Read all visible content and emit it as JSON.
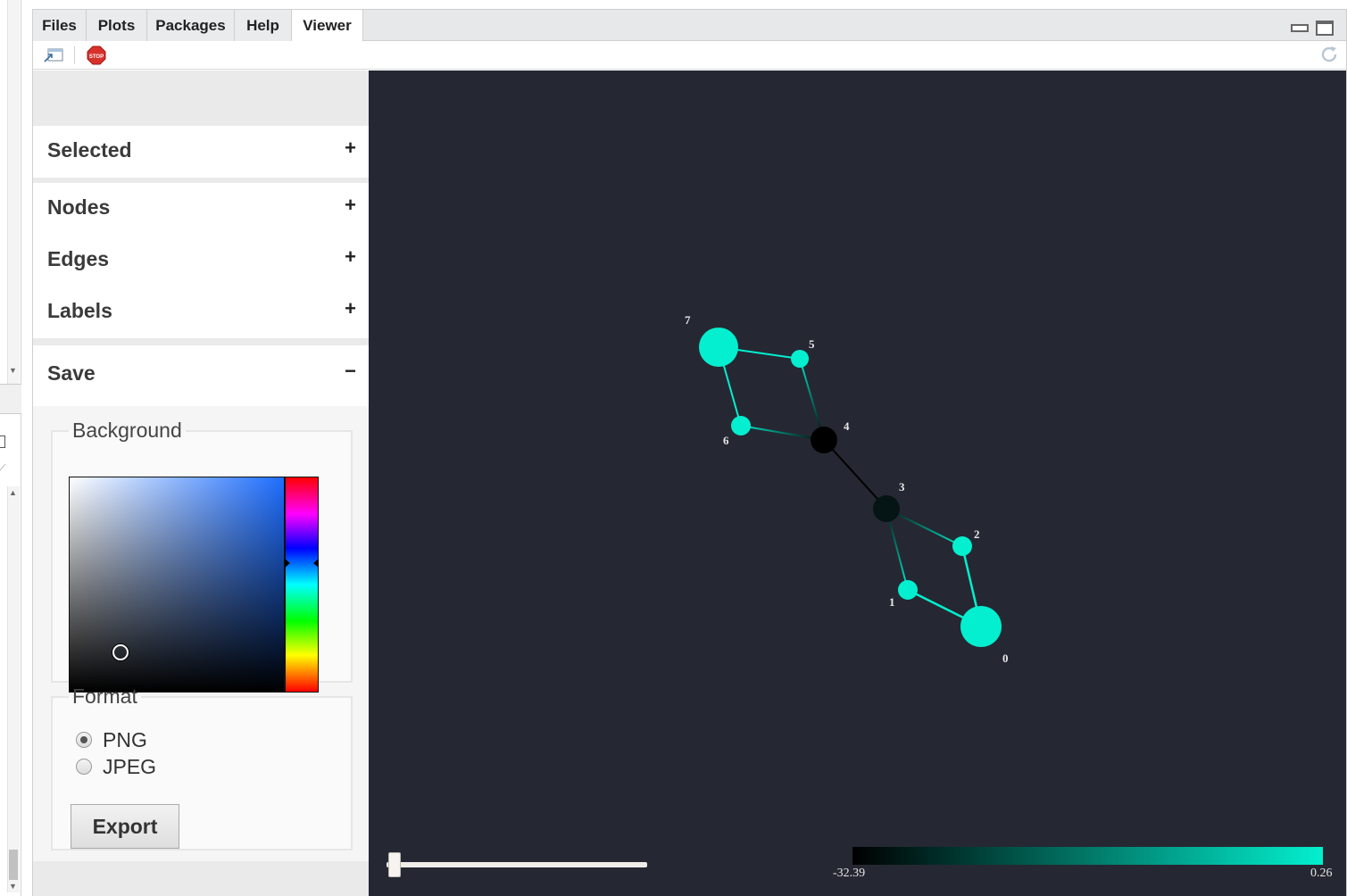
{
  "tabs": [
    {
      "label": "Files"
    },
    {
      "label": "Plots"
    },
    {
      "label": "Packages"
    },
    {
      "label": "Help"
    },
    {
      "label": "Viewer",
      "active": true
    }
  ],
  "toolbar": {
    "open_icon": "open-in-browser-icon",
    "stop_icon": "stop-sign-icon",
    "stop_text": "STOP",
    "refresh_icon": "refresh-icon"
  },
  "sidebar": {
    "sections": [
      {
        "title": "Selected",
        "toggle": "+"
      },
      {
        "title": "Nodes",
        "toggle": "+"
      },
      {
        "title": "Edges",
        "toggle": "+"
      },
      {
        "title": "Labels",
        "toggle": "+"
      },
      {
        "title": "Save",
        "toggle": "−"
      }
    ],
    "save": {
      "background_legend": "Background",
      "format_legend": "Format",
      "formats": [
        {
          "label": "PNG",
          "checked": true
        },
        {
          "label": "JPEG",
          "checked": false
        }
      ],
      "export_label": "Export"
    }
  },
  "graph": {
    "nodes": [
      {
        "id": "0",
        "color": "#03efcf",
        "value": 0.26
      },
      {
        "id": "1",
        "color": "#03efcf"
      },
      {
        "id": "2",
        "color": "#03efcf"
      },
      {
        "id": "3",
        "color": "#051414"
      },
      {
        "id": "4",
        "color": "#000000",
        "value": -32.39
      },
      {
        "id": "5",
        "color": "#03efcf"
      },
      {
        "id": "6",
        "color": "#03efcf"
      },
      {
        "id": "7",
        "color": "#03efcf"
      }
    ],
    "edges": [
      {
        "source": "7",
        "target": "5"
      },
      {
        "source": "7",
        "target": "6"
      },
      {
        "source": "5",
        "target": "4"
      },
      {
        "source": "6",
        "target": "4"
      },
      {
        "source": "4",
        "target": "3"
      },
      {
        "source": "3",
        "target": "2"
      },
      {
        "source": "3",
        "target": "1"
      },
      {
        "source": "2",
        "target": "0"
      },
      {
        "source": "1",
        "target": "0"
      }
    ]
  },
  "colorbar": {
    "min_label": "-32.39",
    "max_label": "0.26",
    "min_color": "#000000",
    "max_color": "#03efcf"
  }
}
